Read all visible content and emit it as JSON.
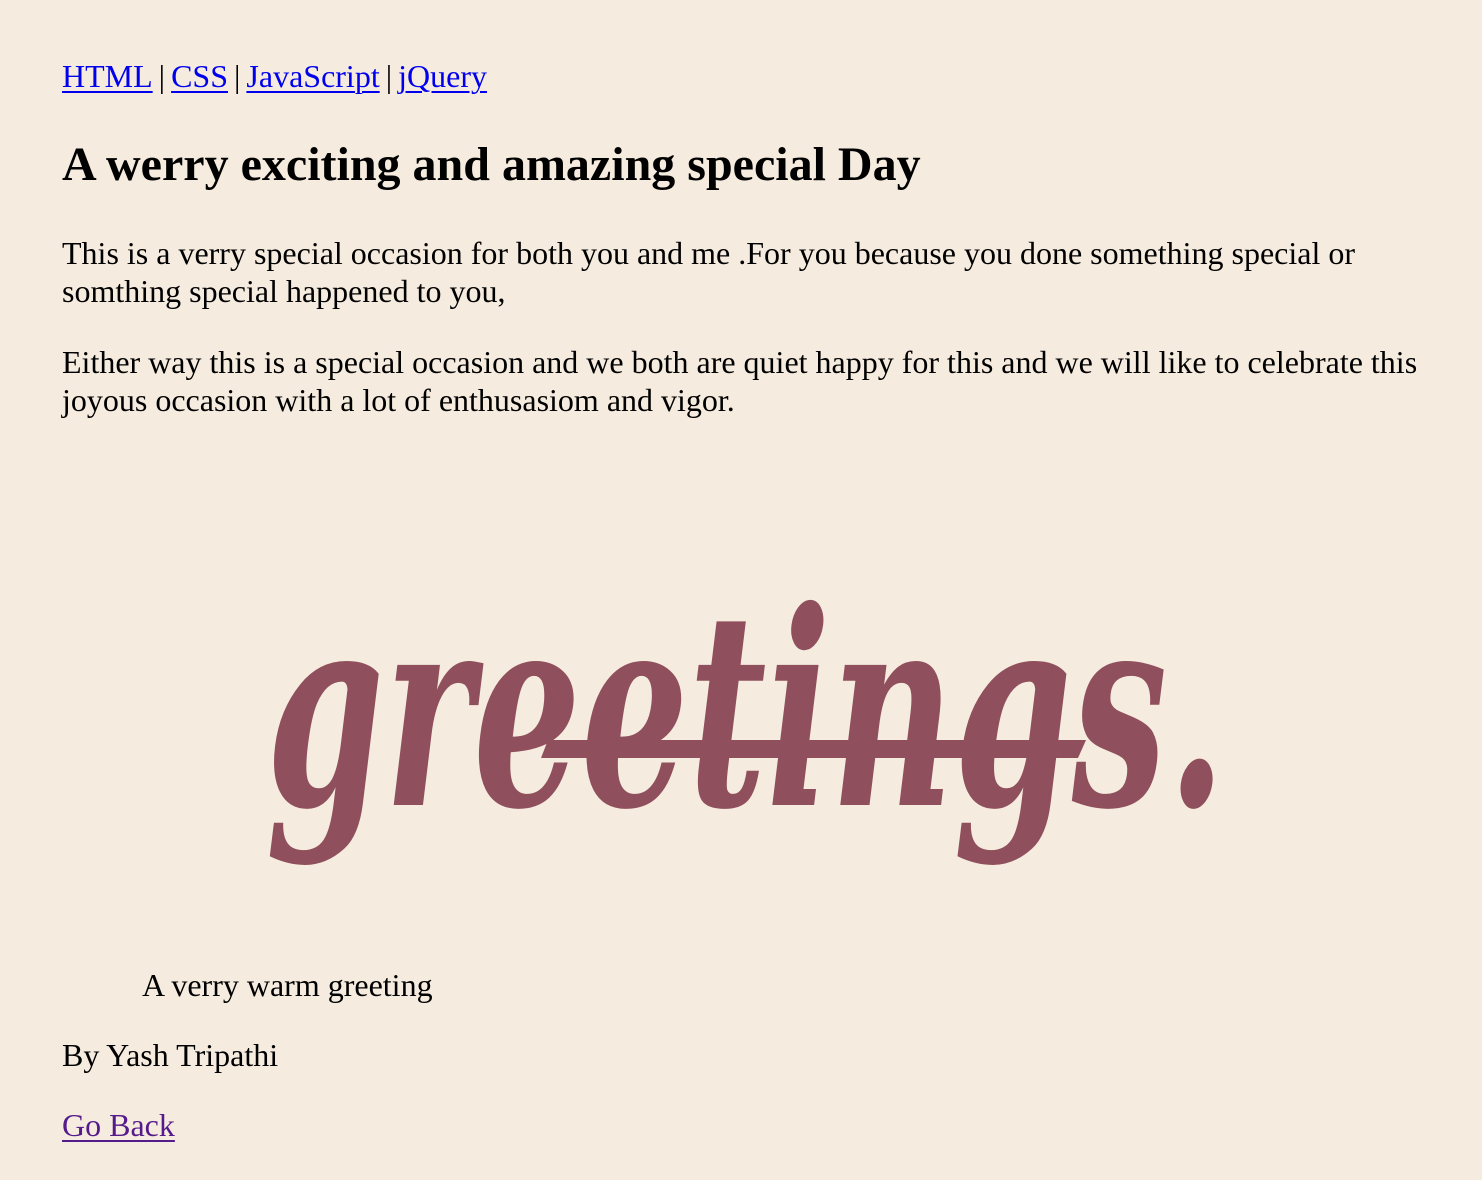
{
  "nav": {
    "links": [
      "HTML",
      "CSS",
      "JavaScript",
      "jQuery"
    ],
    "separator": "|"
  },
  "article": {
    "heading": "A werry exciting and amazing special Day",
    "paragraphs": [
      "This is a verry special occasion for both you and me .For you because you done something special or somthing special happened to you,",
      "Either way this is a special occasion and we both are quiet happy for this and we will like to celebrate this joyous occasion with a lot of enthusasiom and vigor."
    ]
  },
  "image": {
    "art_text": "greetings.",
    "art_color": "#8f4f5c",
    "caption": "A verry warm greeting"
  },
  "author": "By Yash Tripathi",
  "back_link": "Go Back",
  "colors": {
    "background": "#f5ebde",
    "link": "#0000ee",
    "visited_link": "#551a8b"
  }
}
